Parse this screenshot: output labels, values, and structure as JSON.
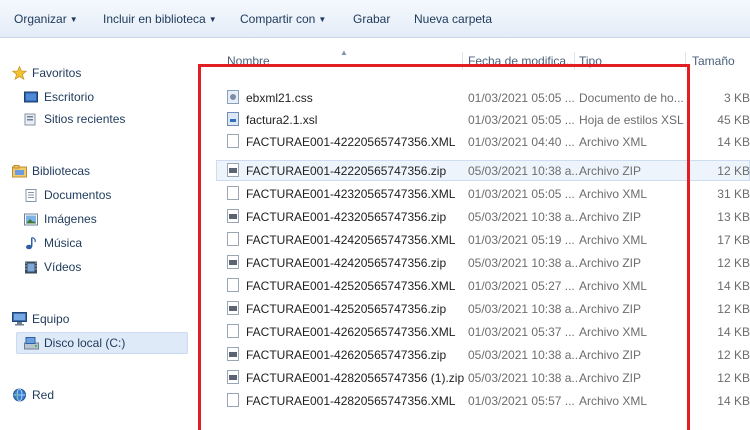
{
  "toolbar": {
    "organize": "Organizar",
    "include_library": "Incluir en biblioteca",
    "share_with": "Compartir con",
    "burn": "Grabar",
    "new_folder": "Nueva carpeta"
  },
  "nav": {
    "favorites": "Favoritos",
    "desktop": "Escritorio",
    "recent": "Sitios recientes",
    "libraries": "Bibliotecas",
    "documents": "Documentos",
    "pictures": "Imágenes",
    "music": "Música",
    "videos": "Vídeos",
    "computer": "Equipo",
    "local_disk": "Disco local (C:)",
    "network": "Red"
  },
  "columns": {
    "name": "Nombre",
    "date": "Fecha de modifica...",
    "type": "Tipo",
    "size": "Tamaño"
  },
  "files": [
    {
      "name": "ebxml21.css",
      "date": "01/03/2021 05:05 ...",
      "type": "Documento de ho...",
      "size": "3 KB",
      "icon": "css-file-icon"
    },
    {
      "name": "factura2.1.xsl",
      "date": "01/03/2021 05:05 ...",
      "type": "Hoja de estilos XSL",
      "size": "45 KB",
      "icon": "xsl-file-icon"
    },
    {
      "name": "FACTURAE001-42220565747356.XML",
      "date": "01/03/2021 04:40 ...",
      "type": "Archivo XML",
      "size": "14 KB",
      "icon": "xml-file-icon"
    },
    {
      "name": "FACTURAE001-42220565747356.zip",
      "date": "05/03/2021 10:38 a...",
      "type": "Archivo ZIP",
      "size": "12 KB",
      "icon": "zip-file-icon"
    },
    {
      "name": "FACTURAE001-42320565747356.XML",
      "date": "01/03/2021 05:05 ...",
      "type": "Archivo XML",
      "size": "31 KB",
      "icon": "xml-file-icon"
    },
    {
      "name": "FACTURAE001-42320565747356.zip",
      "date": "05/03/2021 10:38 a...",
      "type": "Archivo ZIP",
      "size": "13 KB",
      "icon": "zip-file-icon"
    },
    {
      "name": "FACTURAE001-42420565747356.XML",
      "date": "01/03/2021 05:19 ...",
      "type": "Archivo XML",
      "size": "17 KB",
      "icon": "xml-file-icon"
    },
    {
      "name": "FACTURAE001-42420565747356.zip",
      "date": "05/03/2021 10:38 a...",
      "type": "Archivo ZIP",
      "size": "12 KB",
      "icon": "zip-file-icon"
    },
    {
      "name": "FACTURAE001-42520565747356.XML",
      "date": "01/03/2021 05:27 ...",
      "type": "Archivo XML",
      "size": "14 KB",
      "icon": "xml-file-icon"
    },
    {
      "name": "FACTURAE001-42520565747356.zip",
      "date": "05/03/2021 10:38 a...",
      "type": "Archivo ZIP",
      "size": "12 KB",
      "icon": "zip-file-icon"
    },
    {
      "name": "FACTURAE001-42620565747356.XML",
      "date": "01/03/2021 05:37 ...",
      "type": "Archivo XML",
      "size": "14 KB",
      "icon": "xml-file-icon"
    },
    {
      "name": "FACTURAE001-42620565747356.zip",
      "date": "05/03/2021 10:38 a...",
      "type": "Archivo ZIP",
      "size": "12 KB",
      "icon": "zip-file-icon"
    },
    {
      "name": "FACTURAE001-42820565747356 (1).zip",
      "date": "05/03/2021 10:38 a...",
      "type": "Archivo ZIP",
      "size": "12 KB",
      "icon": "zip-file-icon"
    },
    {
      "name": "FACTURAE001-42820565747356.XML",
      "date": "01/03/2021 05:57 ...",
      "type": "Archivo XML",
      "size": "14 KB",
      "icon": "xml-file-icon"
    }
  ],
  "colors": {
    "annotation": "#e21d24",
    "row_highlight": "#eef4fc",
    "nav_selected": "#dfeaf8"
  }
}
